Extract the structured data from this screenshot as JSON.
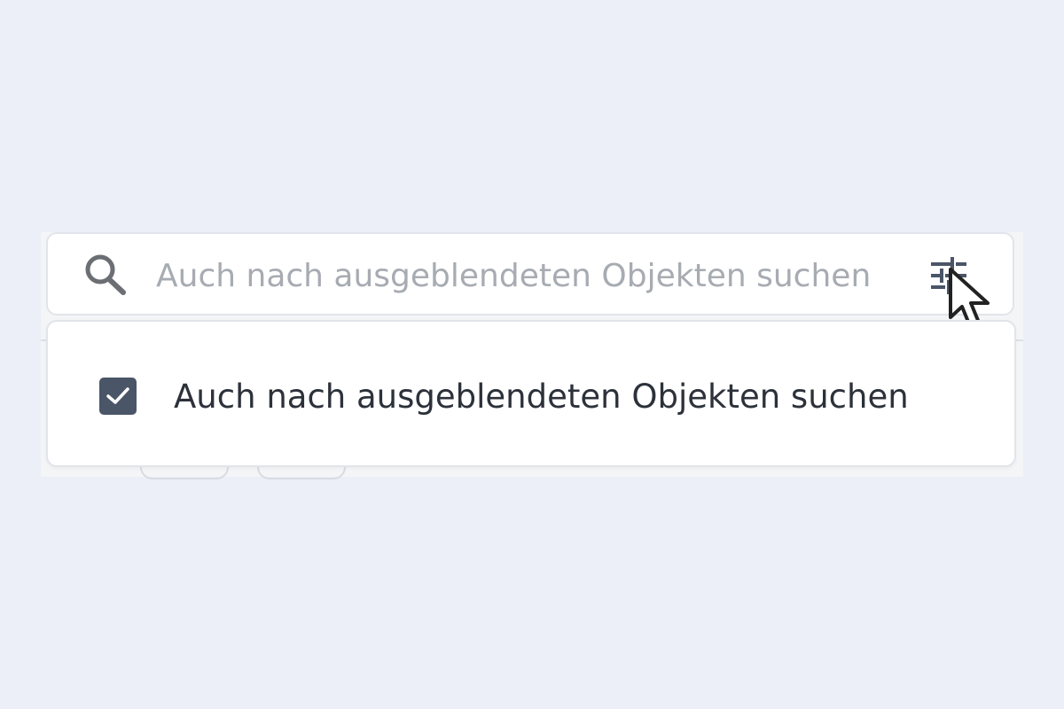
{
  "search": {
    "placeholder": "Auch nach ausgeblendeten Objekten suchen",
    "value": "",
    "icon": "search-icon",
    "filter_icon": "tune-icon"
  },
  "dropdown": {
    "options": [
      {
        "label": "Auch nach ausgeblendeten Objekten suchen",
        "checked": true
      }
    ]
  },
  "colors": {
    "background": "#ECEFF7",
    "checkbox": "#4A5568",
    "filter_icon": "#4A5568",
    "icon_gray": "#6B6E73"
  }
}
